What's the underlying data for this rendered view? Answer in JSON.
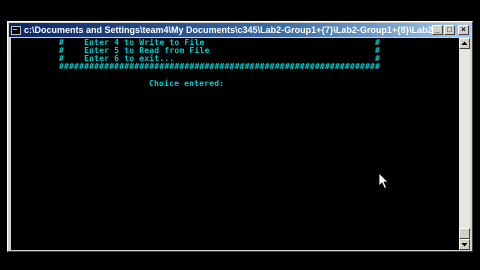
{
  "window": {
    "title": "c:\\Documents and Settings\\team4\\My Documents\\c345\\Lab2-Group1+{7}\\Lab2-Group1+{8}\\Lab2-G...",
    "minimize_glyph": "_",
    "maximize_glyph": "□",
    "close_glyph": "×"
  },
  "console": {
    "lines": [
      "#    Enter 4 to Write to File                                  #",
      "#    Enter 5 to Read from File                                 #",
      "#    Enter 6 to exit...                                        #",
      "################################################################",
      "Choice entered:"
    ],
    "text_color": "#00cccc",
    "background": "#000000"
  },
  "colors": {
    "titlebar_start": "#0a246a",
    "titlebar_end": "#a6caf0",
    "chrome": "#d4d0c8"
  },
  "icons": {
    "window_icon": "console-icon",
    "cursor": "mouse-pointer-icon"
  }
}
